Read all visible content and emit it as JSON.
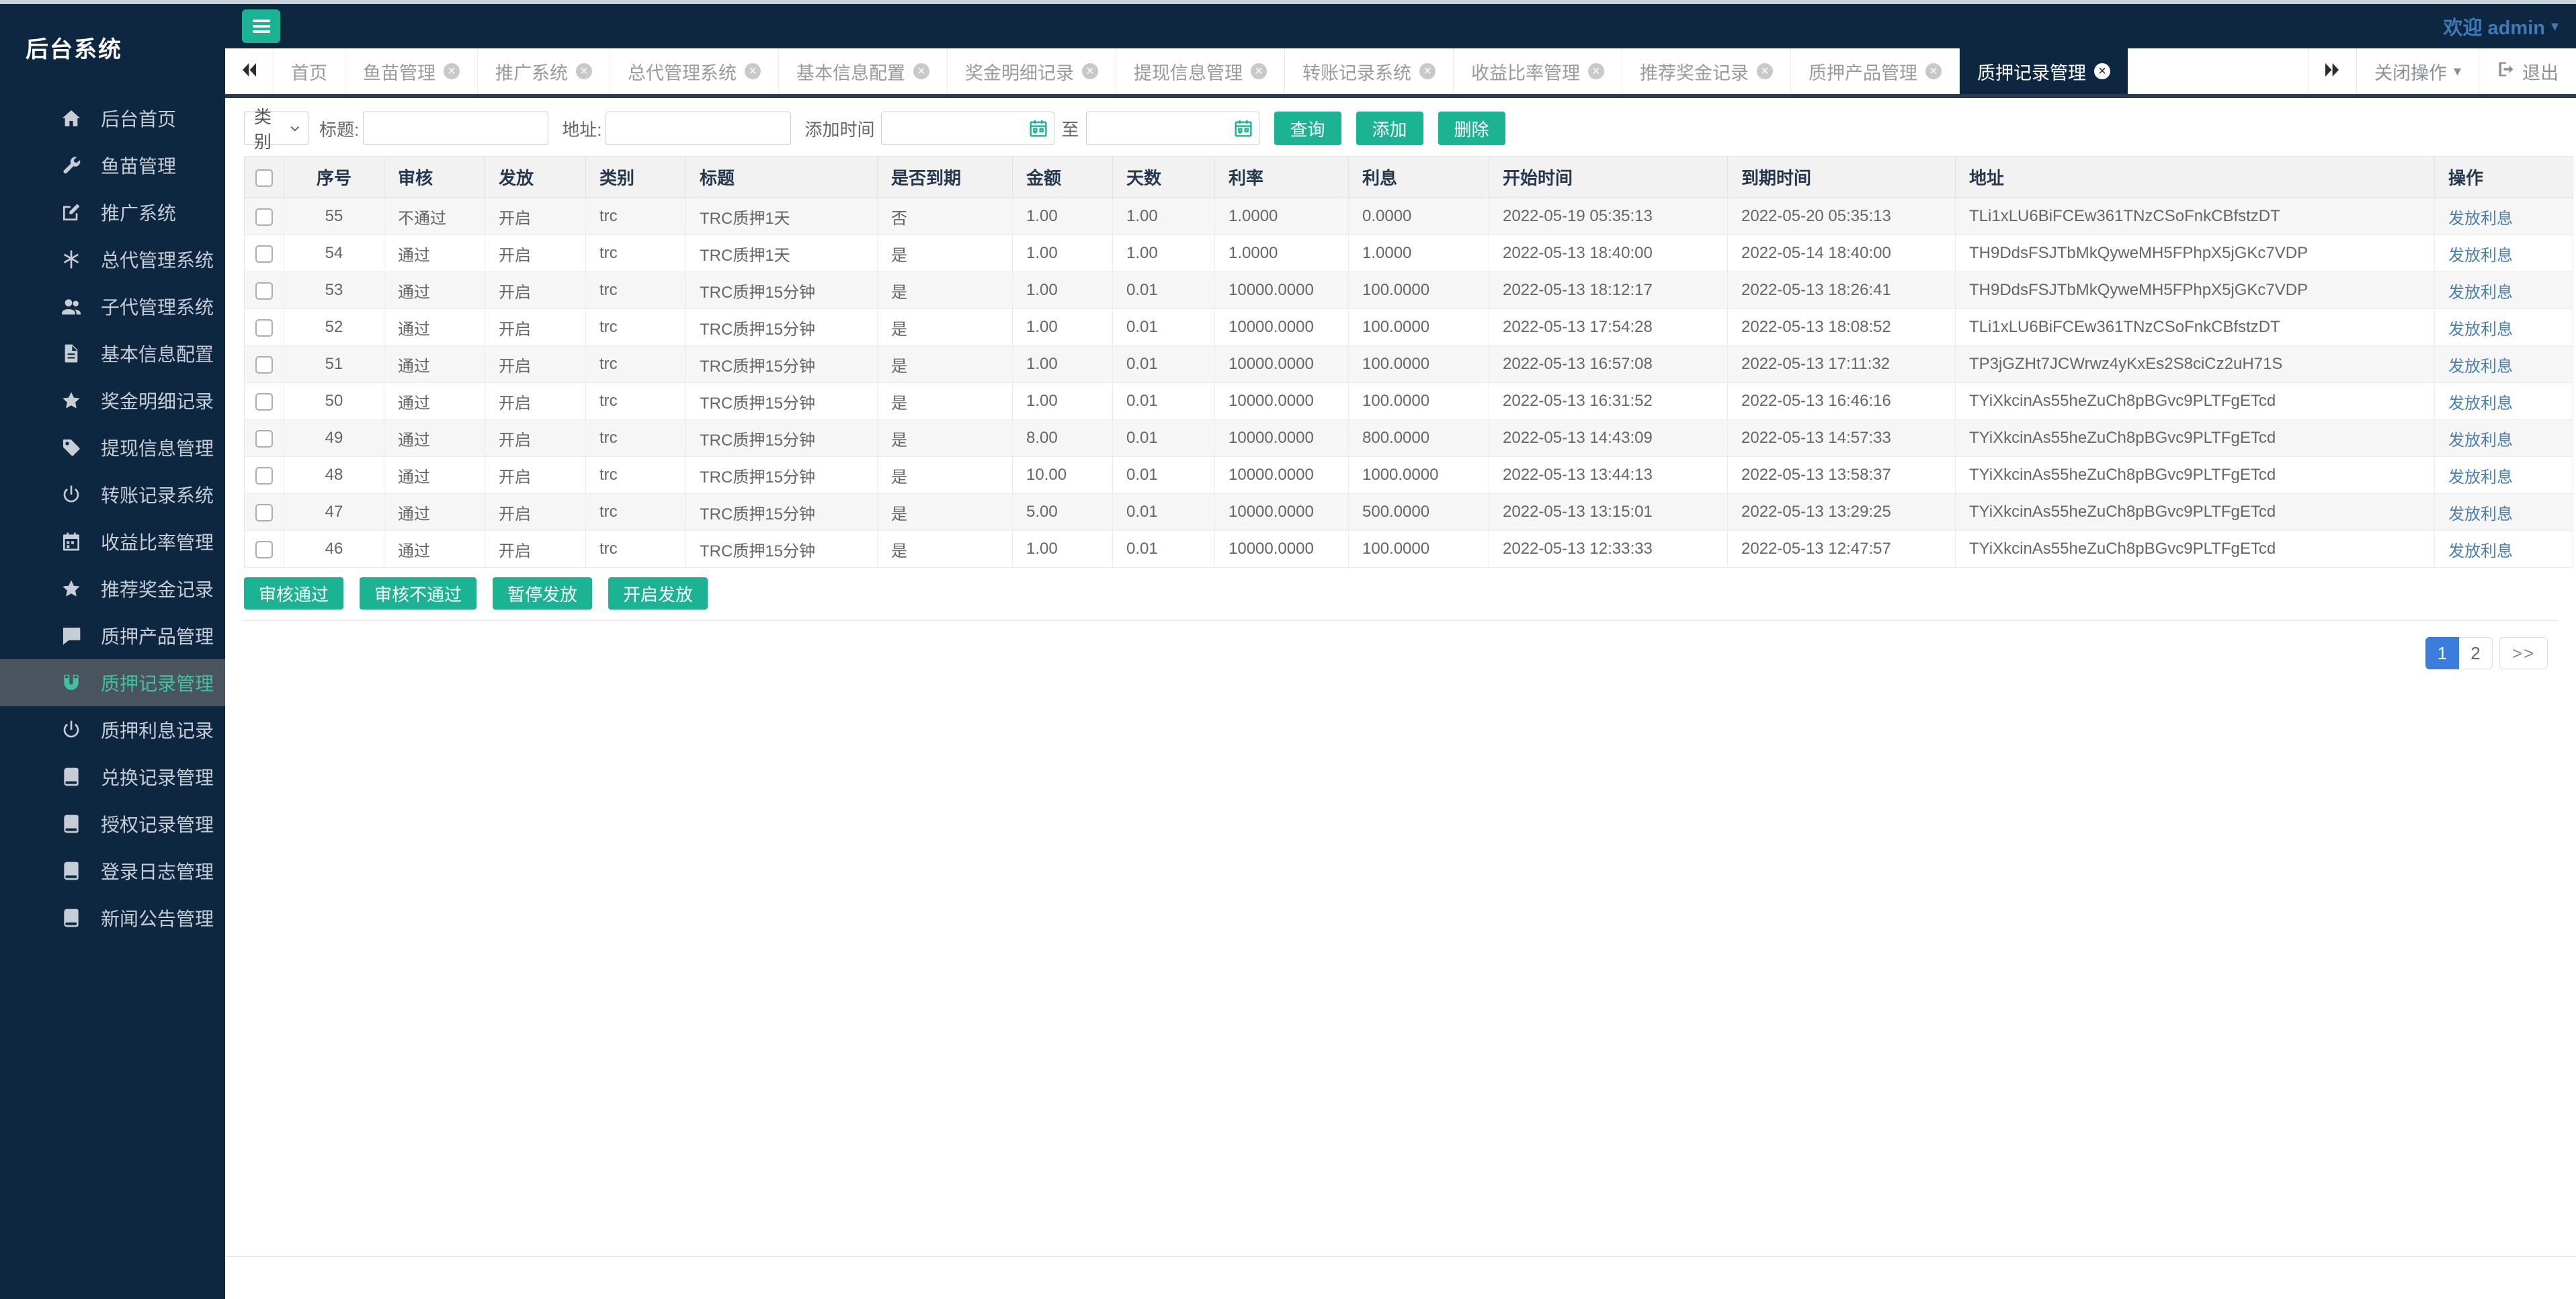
{
  "colors": {
    "navy": "#0d2740",
    "accent_green": "#1cb394",
    "sidebar_active_text": "#3fc29c",
    "sidebar_active_bg": "#4a545f",
    "link_blue": "#4a80b0",
    "pager_active_blue": "#3b7ddd",
    "welcome_blue": "#3f7ab8"
  },
  "app": {
    "title": "后台系统",
    "welcome": "欢迎 admin"
  },
  "sidebar": {
    "items": [
      {
        "label": "后台首页",
        "icon": "home-icon",
        "active": false
      },
      {
        "label": "鱼苗管理",
        "icon": "wrench-icon",
        "active": false
      },
      {
        "label": "推广系统",
        "icon": "edit-icon",
        "active": false
      },
      {
        "label": "总代管理系统",
        "icon": "asterisk-icon",
        "active": false
      },
      {
        "label": "子代管理系统",
        "icon": "users-icon",
        "active": false
      },
      {
        "label": "基本信息配置",
        "icon": "document-icon",
        "active": false
      },
      {
        "label": "奖金明细记录",
        "icon": "star-icon",
        "active": false
      },
      {
        "label": "提现信息管理",
        "icon": "tag-icon",
        "active": false
      },
      {
        "label": "转账记录系统",
        "icon": "power-icon",
        "active": false
      },
      {
        "label": "收益比率管理",
        "icon": "calendar-icon",
        "active": false
      },
      {
        "label": "推荐奖金记录",
        "icon": "star-icon",
        "active": false
      },
      {
        "label": "质押产品管理",
        "icon": "comment-icon",
        "active": false
      },
      {
        "label": "质押记录管理",
        "icon": "magnet-icon",
        "active": true
      },
      {
        "label": "质押利息记录",
        "icon": "power-icon",
        "active": false
      },
      {
        "label": "兑换记录管理",
        "icon": "book-icon",
        "active": false
      },
      {
        "label": "授权记录管理",
        "icon": "book-icon",
        "active": false
      },
      {
        "label": "登录日志管理",
        "icon": "book-icon",
        "active": false
      },
      {
        "label": "新闻公告管理",
        "icon": "book-icon",
        "active": false
      }
    ]
  },
  "tabbar": {
    "tabs": [
      {
        "label": "首页",
        "closable": false,
        "active": false
      },
      {
        "label": "鱼苗管理",
        "closable": true,
        "active": false
      },
      {
        "label": "推广系统",
        "closable": true,
        "active": false
      },
      {
        "label": "总代管理系统",
        "closable": true,
        "active": false
      },
      {
        "label": "基本信息配置",
        "closable": true,
        "active": false
      },
      {
        "label": "奖金明细记录",
        "closable": true,
        "active": false
      },
      {
        "label": "提现信息管理",
        "closable": true,
        "active": false
      },
      {
        "label": "转账记录系统",
        "closable": true,
        "active": false
      },
      {
        "label": "收益比率管理",
        "closable": true,
        "active": false
      },
      {
        "label": "推荐奖金记录",
        "closable": true,
        "active": false
      },
      {
        "label": "质押产品管理",
        "closable": true,
        "active": false
      },
      {
        "label": "质押记录管理",
        "closable": true,
        "active": true
      }
    ],
    "close_ops": "关闭操作",
    "logout": "退出"
  },
  "filter": {
    "category_value": "类别",
    "title_label": "标题:",
    "address_label": "地址:",
    "addtime_label": "添加时间",
    "to_label": "至",
    "search_label": "查询",
    "add_label": "添加",
    "delete_label": "删除"
  },
  "table": {
    "headers": [
      {
        "key": "check",
        "label": ""
      },
      {
        "key": "id",
        "label": "序号"
      },
      {
        "key": "audit",
        "label": "审核"
      },
      {
        "key": "issue",
        "label": "发放"
      },
      {
        "key": "category",
        "label": "类别"
      },
      {
        "key": "title",
        "label": "标题"
      },
      {
        "key": "expired",
        "label": "是否到期"
      },
      {
        "key": "amount",
        "label": "金额"
      },
      {
        "key": "days",
        "label": "天数"
      },
      {
        "key": "rate",
        "label": "利率"
      },
      {
        "key": "interest",
        "label": "利息"
      },
      {
        "key": "start",
        "label": "开始时间"
      },
      {
        "key": "end",
        "label": "到期时间"
      },
      {
        "key": "address",
        "label": "地址"
      },
      {
        "key": "action",
        "label": "操作"
      }
    ],
    "action_label": "发放利息",
    "rows": [
      {
        "id": "55",
        "audit": "不通过",
        "issue": "开启",
        "category": "trc",
        "title": "TRC质押1天",
        "expired": "否",
        "amount": "1.00",
        "days": "1.00",
        "rate": "1.0000",
        "interest": "0.0000",
        "start": "2022-05-19 05:35:13",
        "end": "2022-05-20 05:35:13",
        "address": "TLi1xLU6BiFCEw361TNzCSoFnkCBfstzDT"
      },
      {
        "id": "54",
        "audit": "通过",
        "issue": "开启",
        "category": "trc",
        "title": "TRC质押1天",
        "expired": "是",
        "amount": "1.00",
        "days": "1.00",
        "rate": "1.0000",
        "interest": "1.0000",
        "start": "2022-05-13 18:40:00",
        "end": "2022-05-14 18:40:00",
        "address": "TH9DdsFSJTbMkQyweMH5FPhpX5jGKc7VDP"
      },
      {
        "id": "53",
        "audit": "通过",
        "issue": "开启",
        "category": "trc",
        "title": "TRC质押15分钟",
        "expired": "是",
        "amount": "1.00",
        "days": "0.01",
        "rate": "10000.0000",
        "interest": "100.0000",
        "start": "2022-05-13 18:12:17",
        "end": "2022-05-13 18:26:41",
        "address": "TH9DdsFSJTbMkQyweMH5FPhpX5jGKc7VDP"
      },
      {
        "id": "52",
        "audit": "通过",
        "issue": "开启",
        "category": "trc",
        "title": "TRC质押15分钟",
        "expired": "是",
        "amount": "1.00",
        "days": "0.01",
        "rate": "10000.0000",
        "interest": "100.0000",
        "start": "2022-05-13 17:54:28",
        "end": "2022-05-13 18:08:52",
        "address": "TLi1xLU6BiFCEw361TNzCSoFnkCBfstzDT"
      },
      {
        "id": "51",
        "audit": "通过",
        "issue": "开启",
        "category": "trc",
        "title": "TRC质押15分钟",
        "expired": "是",
        "amount": "1.00",
        "days": "0.01",
        "rate": "10000.0000",
        "interest": "100.0000",
        "start": "2022-05-13 16:57:08",
        "end": "2022-05-13 17:11:32",
        "address": "TP3jGZHt7JCWrwz4yKxEs2S8ciCz2uH71S"
      },
      {
        "id": "50",
        "audit": "通过",
        "issue": "开启",
        "category": "trc",
        "title": "TRC质押15分钟",
        "expired": "是",
        "amount": "1.00",
        "days": "0.01",
        "rate": "10000.0000",
        "interest": "100.0000",
        "start": "2022-05-13 16:31:52",
        "end": "2022-05-13 16:46:16",
        "address": "TYiXkcinAs55heZuCh8pBGvc9PLTFgETcd"
      },
      {
        "id": "49",
        "audit": "通过",
        "issue": "开启",
        "category": "trc",
        "title": "TRC质押15分钟",
        "expired": "是",
        "amount": "8.00",
        "days": "0.01",
        "rate": "10000.0000",
        "interest": "800.0000",
        "start": "2022-05-13 14:43:09",
        "end": "2022-05-13 14:57:33",
        "address": "TYiXkcinAs55heZuCh8pBGvc9PLTFgETcd"
      },
      {
        "id": "48",
        "audit": "通过",
        "issue": "开启",
        "category": "trc",
        "title": "TRC质押15分钟",
        "expired": "是",
        "amount": "10.00",
        "days": "0.01",
        "rate": "10000.0000",
        "interest": "1000.0000",
        "start": "2022-05-13 13:44:13",
        "end": "2022-05-13 13:58:37",
        "address": "TYiXkcinAs55heZuCh8pBGvc9PLTFgETcd"
      },
      {
        "id": "47",
        "audit": "通过",
        "issue": "开启",
        "category": "trc",
        "title": "TRC质押15分钟",
        "expired": "是",
        "amount": "5.00",
        "days": "0.01",
        "rate": "10000.0000",
        "interest": "500.0000",
        "start": "2022-05-13 13:15:01",
        "end": "2022-05-13 13:29:25",
        "address": "TYiXkcinAs55heZuCh8pBGvc9PLTFgETcd"
      },
      {
        "id": "46",
        "audit": "通过",
        "issue": "开启",
        "category": "trc",
        "title": "TRC质押15分钟",
        "expired": "是",
        "amount": "1.00",
        "days": "0.01",
        "rate": "10000.0000",
        "interest": "100.0000",
        "start": "2022-05-13 12:33:33",
        "end": "2022-05-13 12:47:57",
        "address": "TYiXkcinAs55heZuCh8pBGvc9PLTFgETcd"
      }
    ]
  },
  "batch_actions": [
    {
      "label": "审核通过"
    },
    {
      "label": "审核不通过"
    },
    {
      "label": "暂停发放"
    },
    {
      "label": "开启发放"
    }
  ],
  "pagination": {
    "pages": [
      "1",
      "2"
    ],
    "active_page": "1",
    "next_label": ">>"
  }
}
